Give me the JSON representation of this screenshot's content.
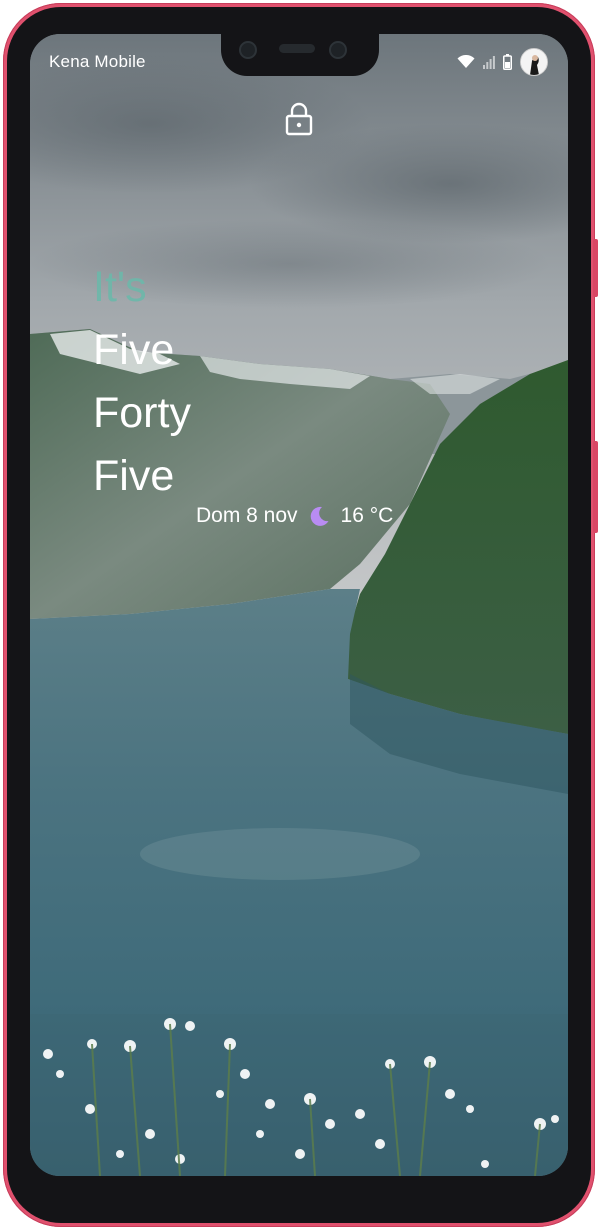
{
  "status_bar": {
    "carrier": "Kena Mobile",
    "icons": [
      "wifi-icon",
      "signal-icon",
      "battery-icon",
      "avatar"
    ]
  },
  "lock_screen": {
    "lock_icon": "lock-icon",
    "clock_words": [
      "It's",
      "Five",
      "Forty",
      "Five"
    ],
    "date": "Dom 8 nov",
    "weather_icon": "moon-icon",
    "temperature": "16 °C"
  },
  "colors": {
    "frame": "#e0516e",
    "its_accent": "#6fb7aa",
    "moon": "#b98cf3"
  }
}
